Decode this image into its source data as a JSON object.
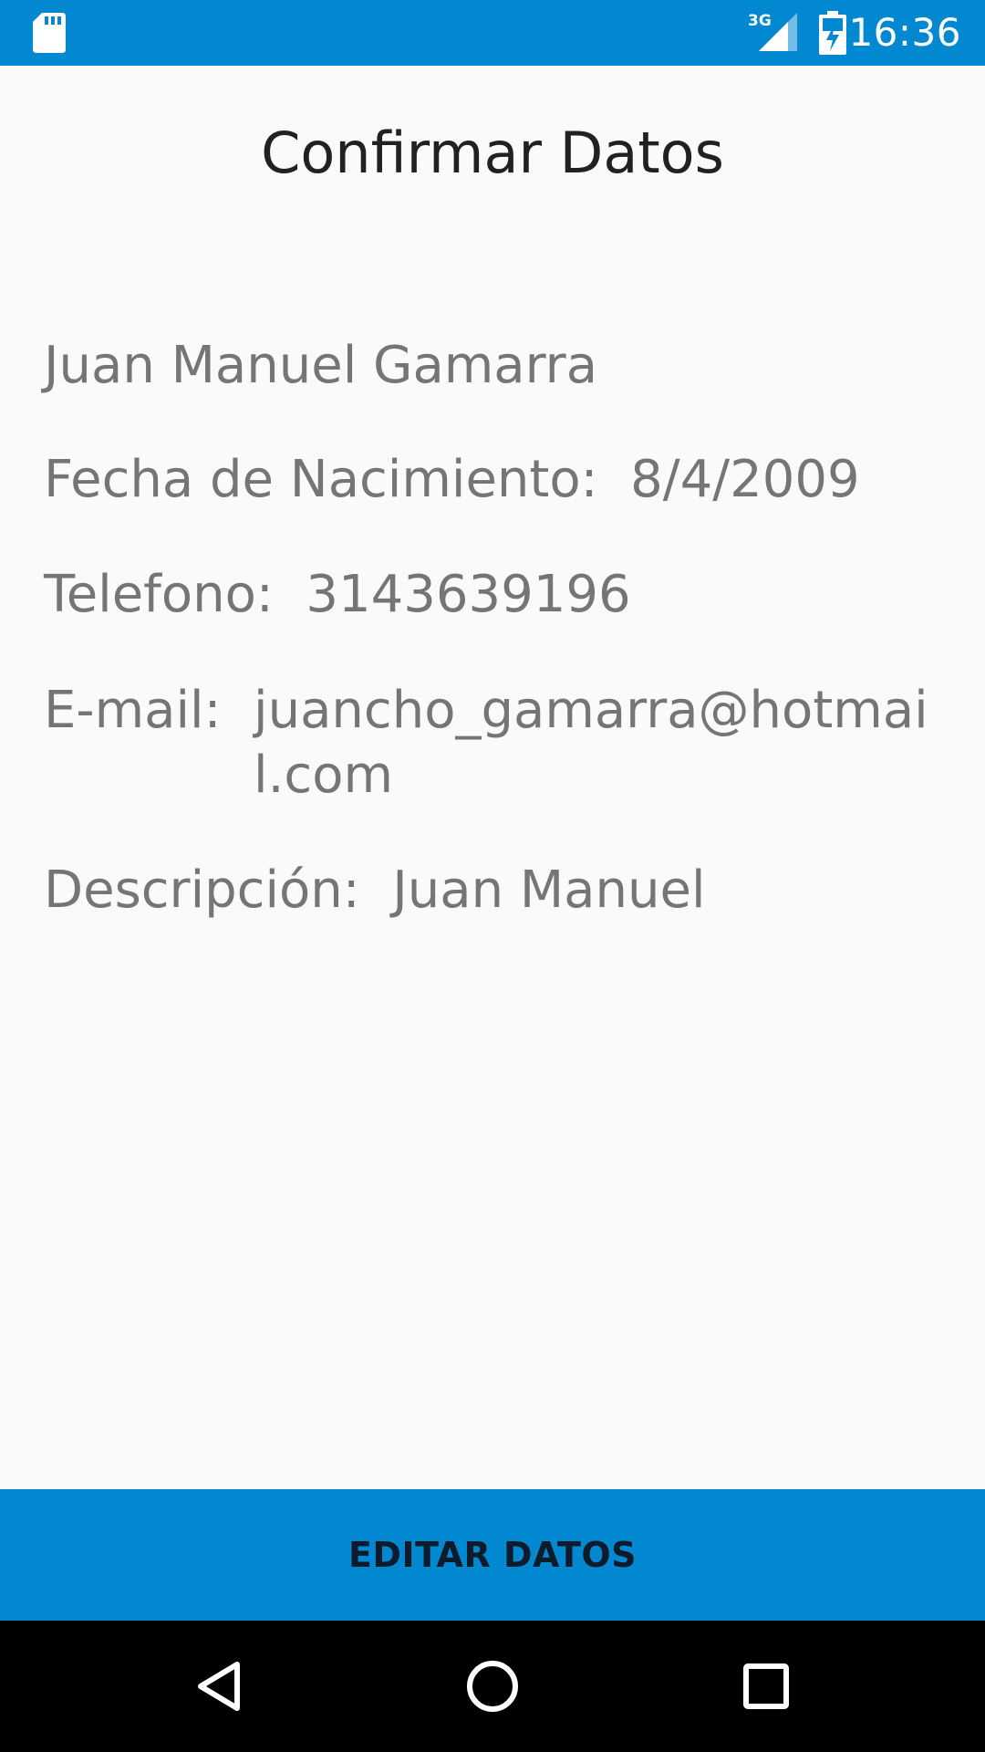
{
  "status_bar": {
    "time": "16:36",
    "network": "3G",
    "icons": [
      "sd-card-icon",
      "signal-3g-icon",
      "battery-charging-icon"
    ]
  },
  "page": {
    "title": "Confirmar Datos"
  },
  "details": {
    "name": "Juan Manuel Gamarra",
    "birth_date_label": "Fecha de Nacimiento:  ",
    "birth_date_value": "8/4/2009",
    "phone_label": "Telefono:  ",
    "phone_value": "3143639196",
    "email_label": "E-mail:  ",
    "email_value": "juancho_gamarra@hotmail.com",
    "description_label": "Descripción:  ",
    "description_value": "Juan Manuel"
  },
  "actions": {
    "edit_label": "EDITAR DATOS"
  },
  "navigation": {
    "buttons": [
      "back-icon",
      "home-icon",
      "recents-icon"
    ]
  },
  "colors": {
    "primary": "#0288d1",
    "background": "#fafafa",
    "title_text": "#212121",
    "body_text": "#757575",
    "nav_bar": "#000000"
  }
}
